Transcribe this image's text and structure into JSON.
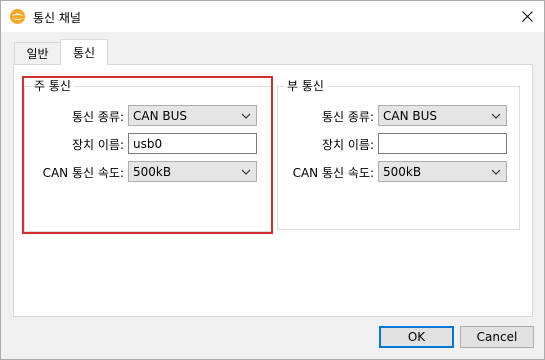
{
  "window": {
    "title": "통신 채널"
  },
  "tabs": [
    {
      "label": "일반",
      "active": false
    },
    {
      "label": "통신",
      "active": true
    }
  ],
  "primary": {
    "legend": "주 통신",
    "comm_type_label": "통신 종류:",
    "comm_type_value": "CAN BUS",
    "device_name_label": "장치 이름:",
    "device_name_value": "usb0",
    "can_speed_label": "CAN 통신 속도:",
    "can_speed_value": "500kB"
  },
  "secondary": {
    "legend": "부 통신",
    "comm_type_label": "통신 종류:",
    "comm_type_value": "CAN BUS",
    "device_name_label": "장치 이름:",
    "device_name_value": "",
    "can_speed_label": "CAN 통신 속도:",
    "can_speed_value": "500kB"
  },
  "buttons": {
    "ok": "OK",
    "cancel": "Cancel"
  },
  "colors": {
    "highlight_border": "#d32f2f",
    "default_button_border": "#0078d7"
  },
  "icons": {
    "app": "app-logo-icon",
    "close": "close-icon",
    "dropdown": "chevron-down-icon"
  }
}
